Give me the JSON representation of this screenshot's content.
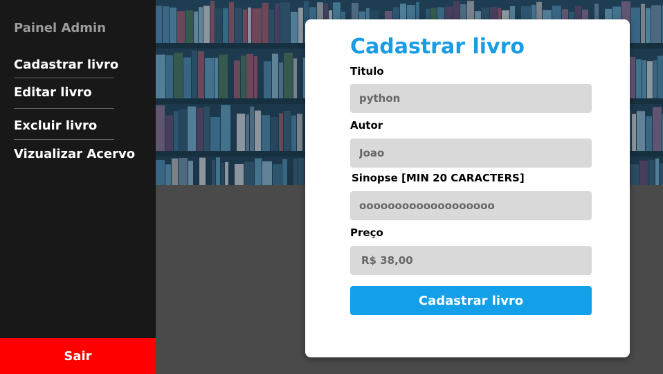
{
  "sidebar": {
    "title": "Painel Admin",
    "items": [
      {
        "label": "Cadastrar livro"
      },
      {
        "label": "Editar livro"
      },
      {
        "label": "Excluir livro"
      },
      {
        "label": "Vizualizar Acervo"
      }
    ],
    "logout_label": "Sair"
  },
  "form": {
    "title": "Cadastrar livro",
    "fields": {
      "titulo": {
        "label": "Titulo",
        "value": "python"
      },
      "autor": {
        "label": "Autor",
        "value": "Joao"
      },
      "sinopse": {
        "label": "Sinopse [MIN 20 CARACTERS]",
        "value": "ooooooooooooooooooo"
      },
      "preco": {
        "label": "Preço",
        "value": "R$ 38,00"
      }
    },
    "submit_label": "Cadastrar livro"
  },
  "colors": {
    "sidebar_bg": "#181818",
    "accent": "#1a9be6",
    "logout_bg": "#ff0000",
    "input_bg": "#d9d9d9"
  }
}
